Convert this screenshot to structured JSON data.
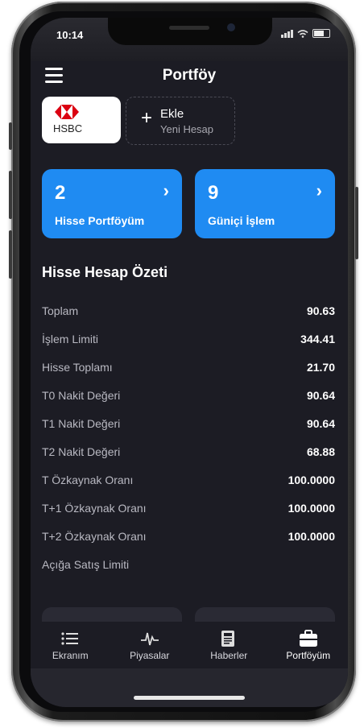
{
  "status_bar": {
    "time": "10:14"
  },
  "header": {
    "title": "Portföy"
  },
  "banks": {
    "selected": {
      "name": "HSBC"
    },
    "add": {
      "label": "Ekle",
      "sub": "Yeni Hesap"
    }
  },
  "cards": [
    {
      "count": "2",
      "label": "Hisse Portföyüm"
    },
    {
      "count": "9",
      "label": "Güniçi İşlem"
    }
  ],
  "summary": {
    "title": "Hisse Hesap Özeti",
    "rows": [
      {
        "label": "Toplam",
        "value": "90.63"
      },
      {
        "label": "İşlem Limiti",
        "value": "344.41"
      },
      {
        "label": "Hisse Toplamı",
        "value": "21.70"
      },
      {
        "label": "T0 Nakit Değeri",
        "value": "90.64"
      },
      {
        "label": "T1 Nakit Değeri",
        "value": "90.64"
      },
      {
        "label": "T2 Nakit Değeri",
        "value": "68.88"
      },
      {
        "label": "T Özkaynak Oranı",
        "value": "100.0000"
      },
      {
        "label": "T+1 Özkaynak Oranı",
        "value": "100.0000"
      },
      {
        "label": "T+2 Özkaynak Oranı",
        "value": "100.0000"
      },
      {
        "label": "Açığa Satış Limiti",
        "value": ""
      }
    ]
  },
  "tabbar": {
    "items": [
      {
        "label": "Ekranım",
        "icon": "list-icon"
      },
      {
        "label": "Piyasalar",
        "icon": "pulse-icon"
      },
      {
        "label": "Haberler",
        "icon": "newspaper-icon"
      },
      {
        "label": "Portföyüm",
        "icon": "briefcase-icon"
      }
    ],
    "active": "Portföyüm"
  },
  "colors": {
    "accent": "#1f8bf2",
    "background": "#1c1c24",
    "hsbc_red": "#db0011"
  }
}
